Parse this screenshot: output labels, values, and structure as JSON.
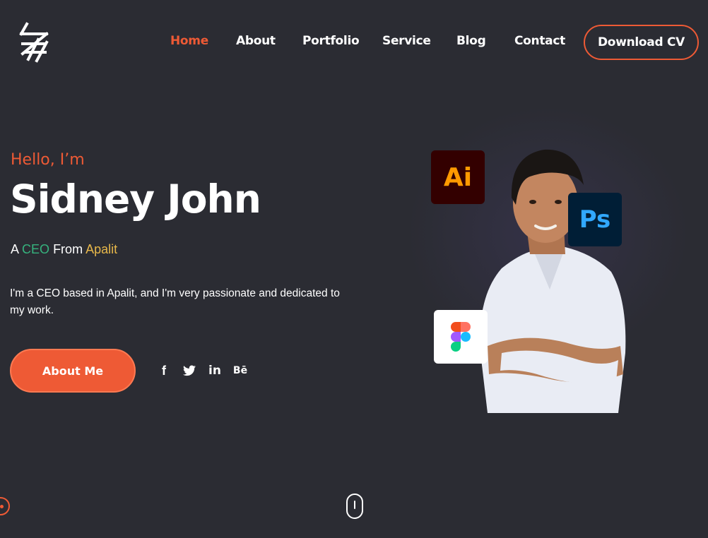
{
  "nav": {
    "items": [
      {
        "label": "Home",
        "active": true
      },
      {
        "label": "About",
        "active": false
      },
      {
        "label": "Portfolio",
        "active": false
      },
      {
        "label": "Service",
        "active": false
      },
      {
        "label": "Blog",
        "active": false
      },
      {
        "label": "Contact",
        "active": false
      }
    ],
    "cta_label": "Download CV"
  },
  "hero": {
    "greeting": "Hello, I’m",
    "name": "Sidney John",
    "role_prefix": "A",
    "role": "CEO",
    "role_from": "From",
    "location": "Apalit",
    "bio": "I'm a CEO based in Apalit, and I'm very passionate and dedicated to my work.",
    "button_label": "About Me"
  },
  "socials": [
    {
      "icon": "facebook-icon",
      "glyph": "f"
    },
    {
      "icon": "twitter-icon",
      "glyph": ""
    },
    {
      "icon": "linkedin-icon",
      "glyph": "in"
    },
    {
      "icon": "behance-icon",
      "glyph": "Bē"
    }
  ],
  "badges": {
    "illustrator": "Ai",
    "photoshop": "Ps",
    "figma": "figma-icon"
  },
  "colors": {
    "background": "#2b2c33",
    "accent": "#ee5a35",
    "role_highlight": "#36b37e",
    "location_highlight": "#e8b84a"
  }
}
